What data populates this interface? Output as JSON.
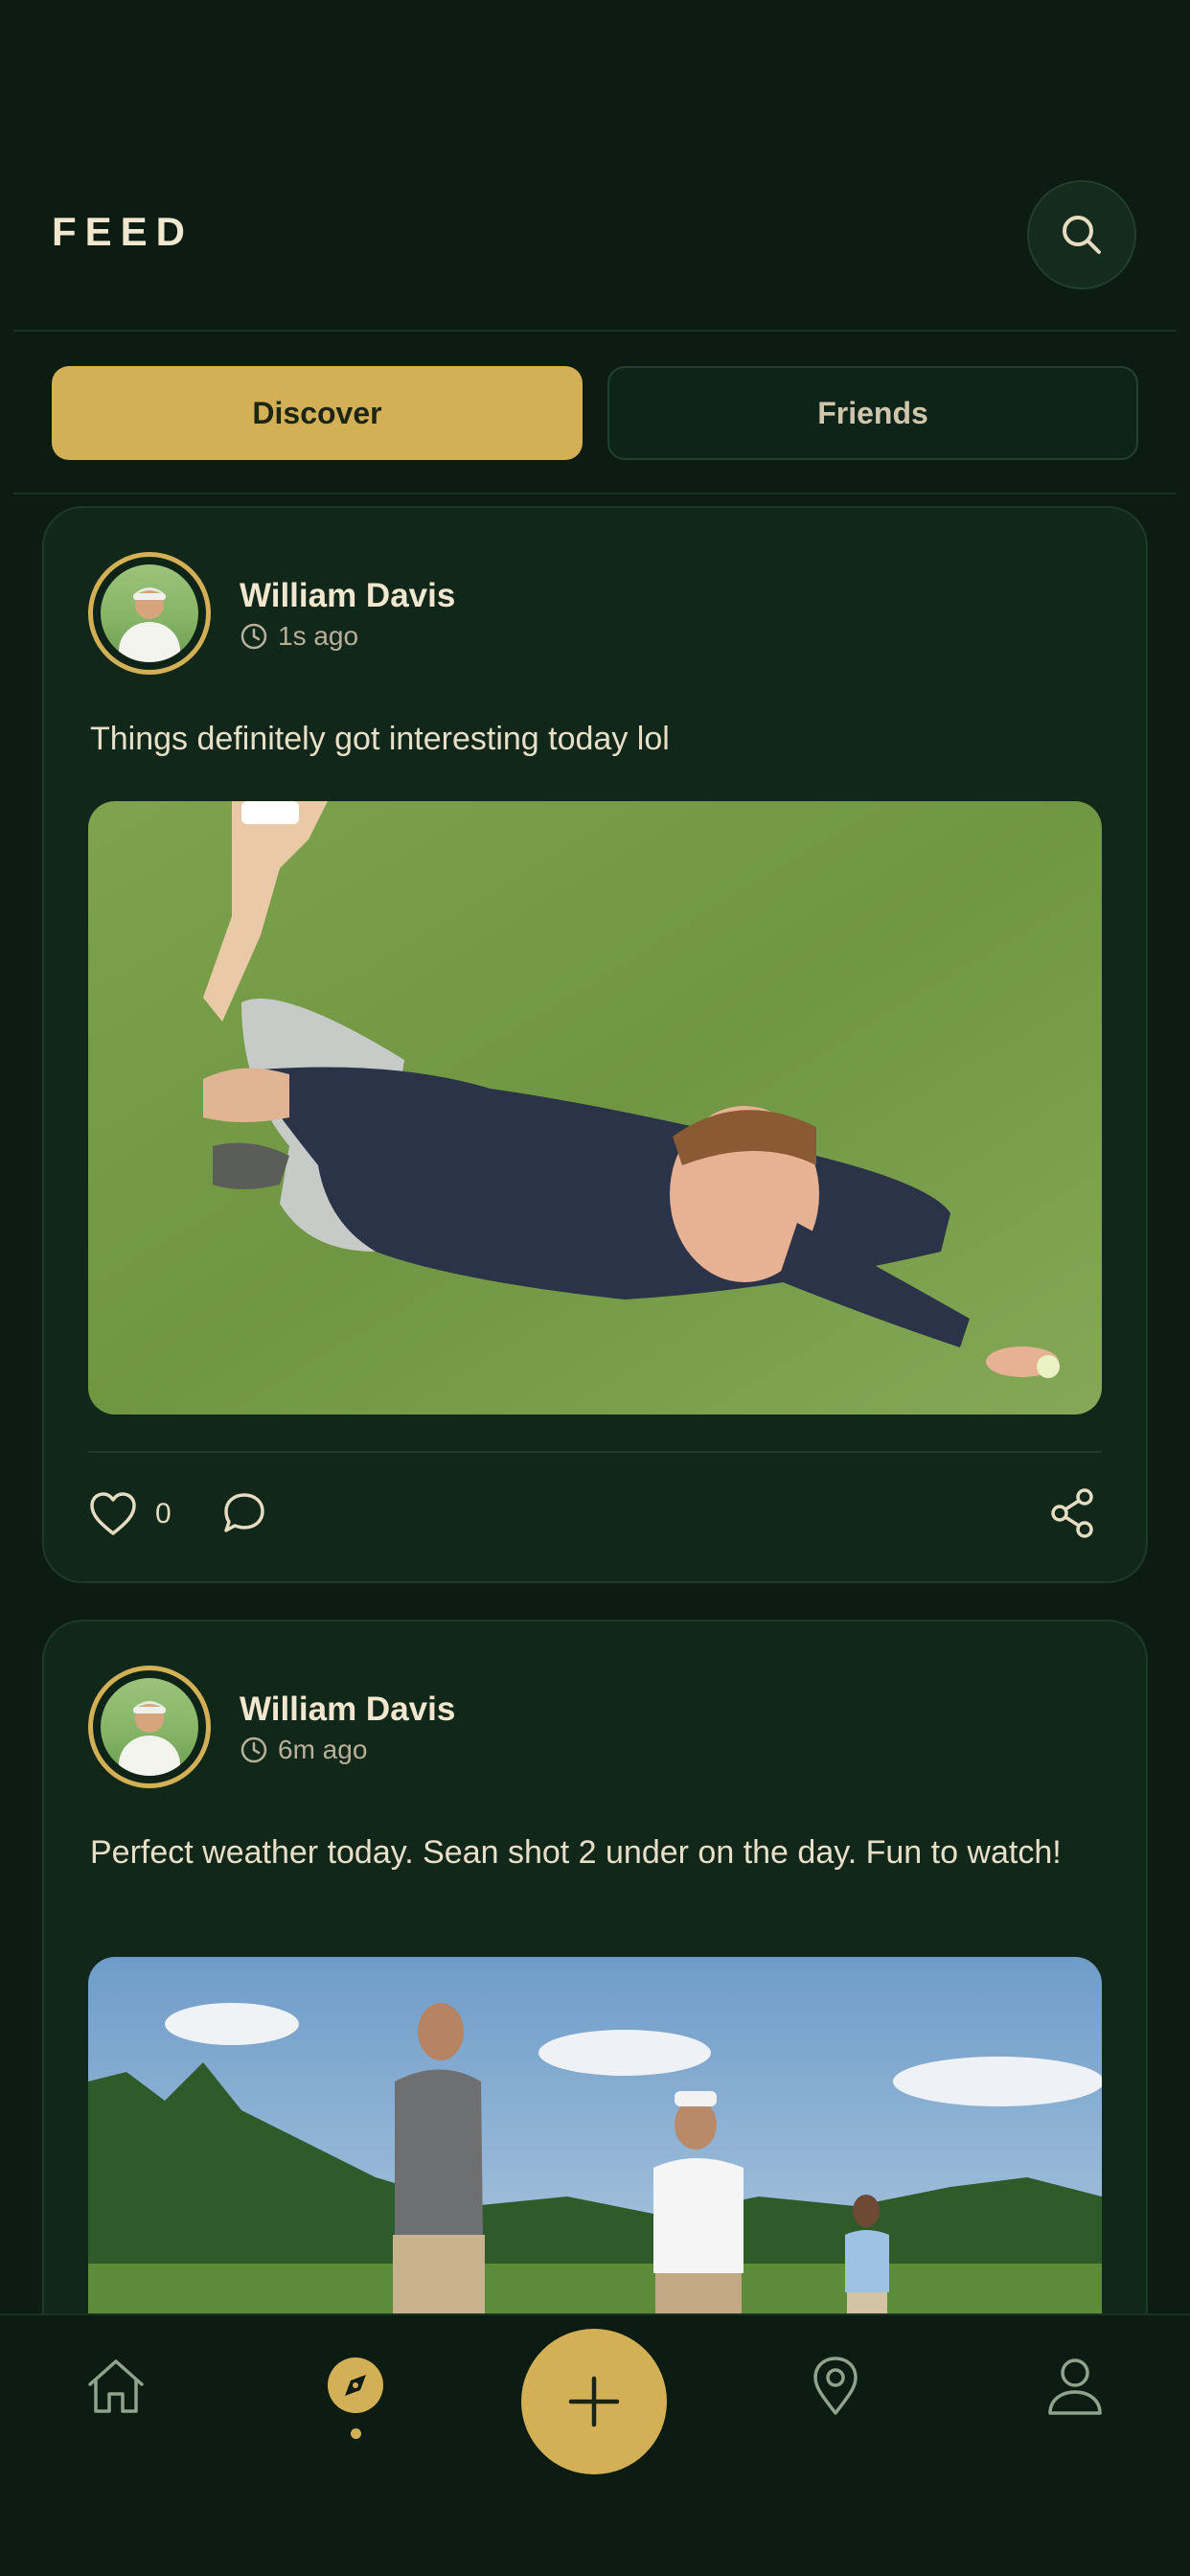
{
  "header": {
    "title": "FEED"
  },
  "tabs": [
    {
      "label": "Discover",
      "active": true
    },
    {
      "label": "Friends",
      "active": false
    }
  ],
  "posts": [
    {
      "author": "William Davis",
      "time": "1s ago",
      "text": "Things definitely got interesting today lol",
      "likes": "0",
      "image_desc": "golfer diving on putting green"
    },
    {
      "author": "William Davis",
      "time": "6m ago",
      "text": "Perfect weather today. Sean shot 2 under on the day. Fun to watch!",
      "image_desc": "three golfers on course under blue sky"
    }
  ],
  "nav": {
    "items": [
      "home-icon",
      "compass-icon",
      "plus-icon",
      "map-pin-icon",
      "profile-icon"
    ],
    "active": "compass-icon"
  },
  "colors": {
    "background": "#0c1c13",
    "card": "#11271a",
    "accent": "#d3b055",
    "text": "#efe6cf"
  }
}
